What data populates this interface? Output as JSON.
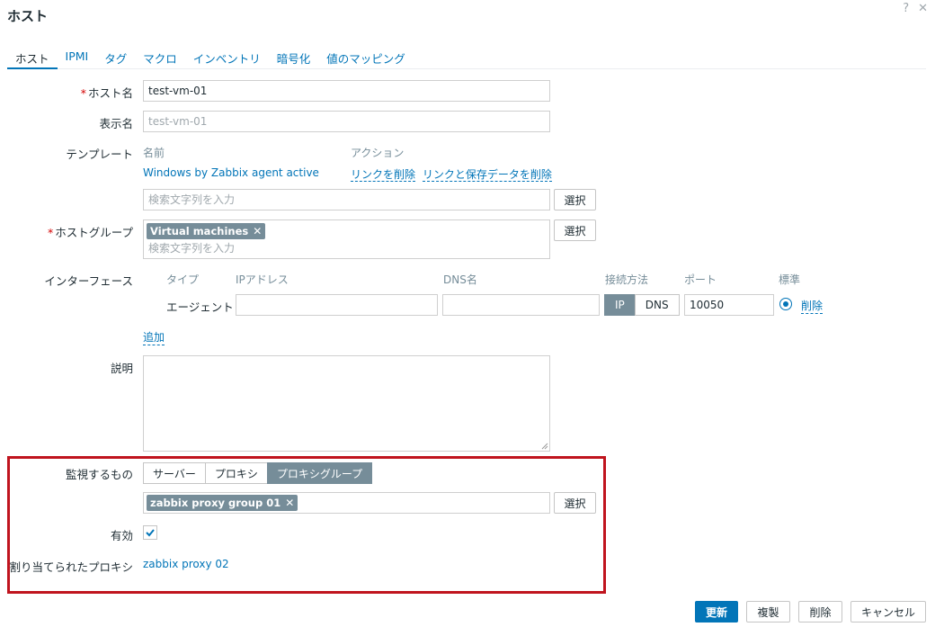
{
  "dialog": {
    "title": "ホスト",
    "help_icon": "?",
    "close_icon": "✕"
  },
  "tabs": [
    {
      "label": "ホスト"
    },
    {
      "label": "IPMI"
    },
    {
      "label": "タグ"
    },
    {
      "label": "マクロ"
    },
    {
      "label": "インベントリ"
    },
    {
      "label": "暗号化"
    },
    {
      "label": "値のマッピング"
    }
  ],
  "host": {
    "hostname_label": "ホスト名",
    "hostname_value": "test-vm-01",
    "visible_label": "表示名",
    "visible_placeholder": "test-vm-01"
  },
  "templates": {
    "label": "テンプレート",
    "col_name": "名前",
    "col_action": "アクション",
    "row_name": "Windows by Zabbix agent active",
    "unlink": "リンクを削除",
    "unlink_clear": "リンクと保存データを削除",
    "search_placeholder": "検索文字列を入力",
    "select_label": "選択"
  },
  "hostgroups": {
    "label": "ホストグループ",
    "tag": "Virtual machines",
    "search_placeholder": "検索文字列を入力",
    "select_label": "選択"
  },
  "interfaces": {
    "label": "インターフェース",
    "col_type": "タイプ",
    "col_ip": "IPアドレス",
    "col_dns": "DNS名",
    "col_connect": "接続方法",
    "col_port": "ポート",
    "col_default": "標準",
    "row_type": "エージェント",
    "ip_value": "",
    "dns_value": "",
    "btn_ip": "IP",
    "btn_dns": "DNS",
    "port_value": "10050",
    "remove": "削除",
    "add": "追加"
  },
  "description": {
    "label": "説明",
    "value": ""
  },
  "monitored_by": {
    "label": "監視するもの",
    "options": [
      "サーバー",
      "プロキシ",
      "プロキシグループ"
    ],
    "selected": "プロキシグループ",
    "group_tag": "zabbix proxy group 01",
    "select_label": "選択"
  },
  "enabled": {
    "label": "有効",
    "checked": true
  },
  "assigned_proxy": {
    "label": "割り当てられたプロキシ",
    "value": "zabbix proxy 02"
  },
  "footer": {
    "update": "更新",
    "clone": "複製",
    "delete": "削除",
    "cancel": "キャンセル"
  }
}
